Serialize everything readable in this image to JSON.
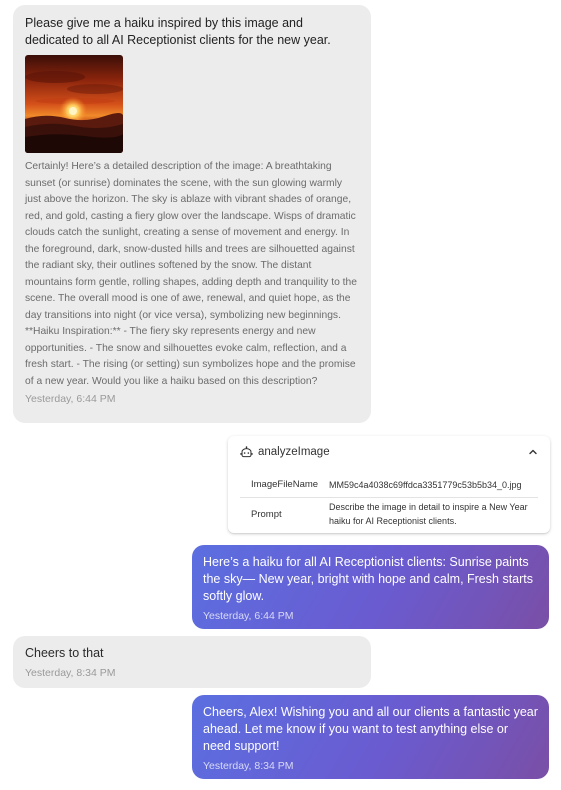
{
  "messages": [
    {
      "prompt": "Please give me a haiku inspired by this image and dedicated to all AI Receptionist clients for the new year.",
      "description": "Certainly! Here’s a detailed description of the image: A breathtaking sunset (or sunrise) dominates the scene, with the sun glowing warmly just above the horizon. The sky is ablaze with vibrant shades of orange, red, and gold, casting a fiery glow over the landscape. Wisps of dramatic clouds catch the sunlight, creating a sense of movement and energy. In the foreground, dark, snow-dusted hills and trees are silhouetted against the radiant sky, their outlines softened by the snow. The distant mountains form gentle, rolling shapes, adding depth and tranquility to the scene. The overall mood is one of awe, renewal, and quiet hope, as the day transitions into night (or vice versa), symbolizing new beginnings. **Haiku Inspiration:** - The fiery sky represents energy and new opportunities. - The snow and silhouettes evoke calm, reflection, and a fresh start. - The rising (or setting) sun symbolizes hope and the promise of a new year. Would you like a haiku based on this description?",
      "timestamp": "Yesterday, 6:44 PM"
    },
    {
      "text": "Here’s a haiku for all AI Receptionist clients: Sunrise paints the sky— New year, bright with hope and calm, Fresh starts softly glow.",
      "timestamp": "Yesterday, 6:44 PM"
    },
    {
      "text": "Cheers to that",
      "timestamp": "Yesterday, 8:34 PM"
    },
    {
      "text": "Cheers, Alex! Wishing you and all our clients a fantastic year ahead. Let me know if you want to test anything else or need support!",
      "timestamp": "Yesterday, 8:34 PM"
    }
  ],
  "tool_call": {
    "name": "analyzeImage",
    "icon": "robot-icon",
    "collapse_icon": "chevron-up-icon",
    "rows": [
      {
        "key": "ImageFileName",
        "value": "MM59c4a4038c69ffdca3351779c53b5b34_0.jpg"
      },
      {
        "key": "Prompt",
        "value": "Describe the image in detail to inspire a New Year haiku for AI Receptionist clients."
      }
    ]
  },
  "colors": {
    "incoming_bubble": "#ececec",
    "outgoing_gradient_start": "#5b6fe0",
    "outgoing_gradient_end": "#7a4fa6"
  }
}
